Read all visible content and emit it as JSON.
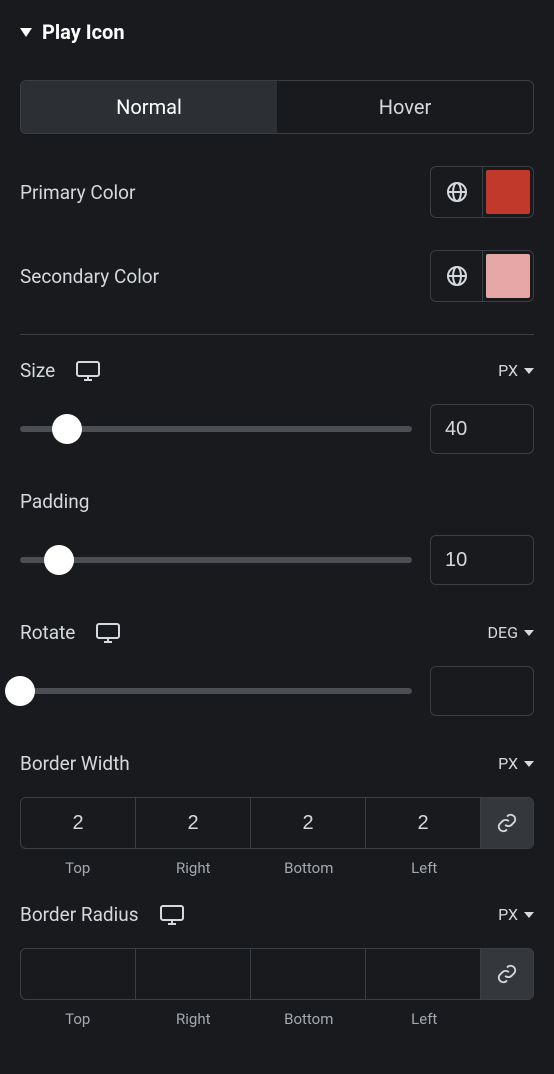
{
  "section": {
    "title": "Play Icon"
  },
  "tabs": {
    "normal": "Normal",
    "hover": "Hover",
    "active": "normal"
  },
  "colors": {
    "primary": {
      "label": "Primary Color",
      "value": "#C0392B"
    },
    "secondary": {
      "label": "Secondary Color",
      "value": "#E6A7A7"
    }
  },
  "size": {
    "label": "Size",
    "unit": "PX",
    "value": "40",
    "percent": 12
  },
  "padding": {
    "label": "Padding",
    "value": "10",
    "percent": 10
  },
  "rotate": {
    "label": "Rotate",
    "unit": "DEG",
    "value": "",
    "percent": 0
  },
  "borderWidth": {
    "label": "Border Width",
    "unit": "PX",
    "top": "2",
    "right": "2",
    "bottom": "2",
    "left": "2",
    "labels": {
      "top": "Top",
      "right": "Right",
      "bottom": "Bottom",
      "left": "Left"
    }
  },
  "borderRadius": {
    "label": "Border Radius",
    "unit": "PX",
    "top": "",
    "right": "",
    "bottom": "",
    "left": "",
    "labels": {
      "top": "Top",
      "right": "Right",
      "bottom": "Bottom",
      "left": "Left"
    }
  }
}
